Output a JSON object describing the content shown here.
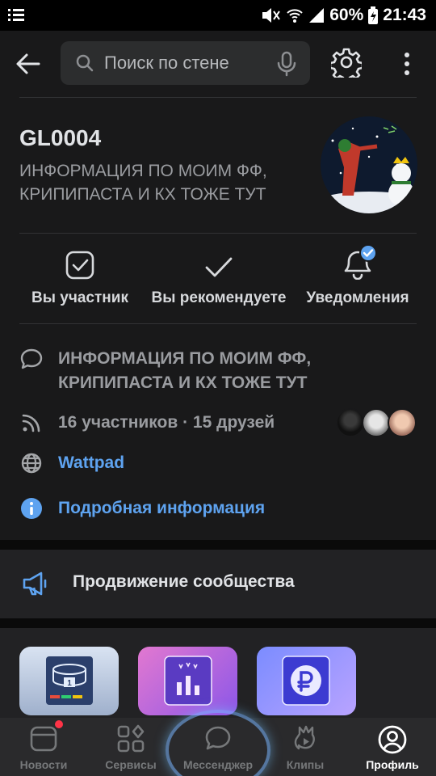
{
  "status_bar": {
    "battery": "60%",
    "time": "21:43"
  },
  "search": {
    "placeholder": "Поиск по стене"
  },
  "group": {
    "name": "GL0004",
    "status": "ИНФОРМАЦИЯ ПО МОИМ ФФ, КРИПИПАСТА И КХ ТОЖЕ ТУТ"
  },
  "actions": [
    {
      "label": "Вы участник",
      "icon": "checkbox-icon"
    },
    {
      "label": "Вы рекомендуете",
      "icon": "check-icon"
    },
    {
      "label": "Уведомления",
      "icon": "bell-icon"
    }
  ],
  "info": {
    "description": "ИНФОРМАЦИЯ ПО МОИМ ФФ, КРИПИПАСТА И КХ ТОЖЕ ТУТ",
    "members": "16 участников · 15 друзей",
    "website": "Wattpad",
    "details": "Подробная информация"
  },
  "promo": {
    "label": "Продвижение сообщества"
  },
  "tabs": [
    {
      "label": "Новости",
      "icon": "news-icon"
    },
    {
      "label": "Сервисы",
      "icon": "services-icon"
    },
    {
      "label": "Мессенджер",
      "icon": "messenger-icon"
    },
    {
      "label": "Клипы",
      "icon": "clips-icon"
    },
    {
      "label": "Профиль",
      "icon": "profile-icon"
    }
  ],
  "colors": {
    "background": "#19191a",
    "accent": "#5ea3f0",
    "badge": "#ff3347"
  }
}
